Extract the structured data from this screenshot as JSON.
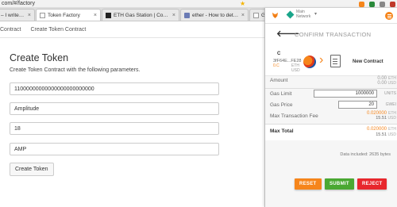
{
  "browser": {
    "url": "com/#/factory",
    "tabs": [
      {
        "label": "– I write, I s"
      },
      {
        "label": "Token Factory"
      },
      {
        "label": "ETH Gas Station | Consum"
      },
      {
        "label": "ether - How to determine"
      },
      {
        "label": "Guid"
      }
    ]
  },
  "nav": {
    "contract": "Contract",
    "create": "Create Token Contract"
  },
  "form": {
    "title": "Create Token",
    "subtitle": "Create Token Contract with the following parameters.",
    "supply": "11000000000000000000000000",
    "name": "Amplitude",
    "decimals": "18",
    "symbol": "AMP",
    "submit": "Create Token"
  },
  "metamask": {
    "network_line1": "Main",
    "network_line2": "Network",
    "caret": "▾",
    "header_title": "CONFIRM TRANSACTION",
    "from_label": "C",
    "from_address": "3fF64E...FE28",
    "from_balance": "0.C",
    "eth": "ETH",
    "usd": "USD",
    "to_label": "New Contract",
    "amount_label": "Amount",
    "amount_value": "0.00",
    "amount_usd": "0.00",
    "gas_limit_label": "Gas Limit",
    "gas_limit_value": "1000000",
    "gas_limit_unit": "UNITS",
    "gas_price_label": "Gas Price",
    "gas_price_value": "20",
    "gas_price_unit": "GWEI",
    "max_fee_label": "Max Transaction Fee",
    "max_fee_value": "0.020000",
    "max_fee_usd": "15.51",
    "max_total_label": "Max Total",
    "max_total_value": "0.020000",
    "max_total_usd": "15.51",
    "data_included": "Data included: 2635 bytes",
    "reset": "RESET",
    "submit": "SUBMIT",
    "reject": "REJECT"
  },
  "colors": {
    "accent": "#f6851b",
    "reset": "#f6851b",
    "submit": "#4aa832",
    "reject": "#e8272d"
  }
}
